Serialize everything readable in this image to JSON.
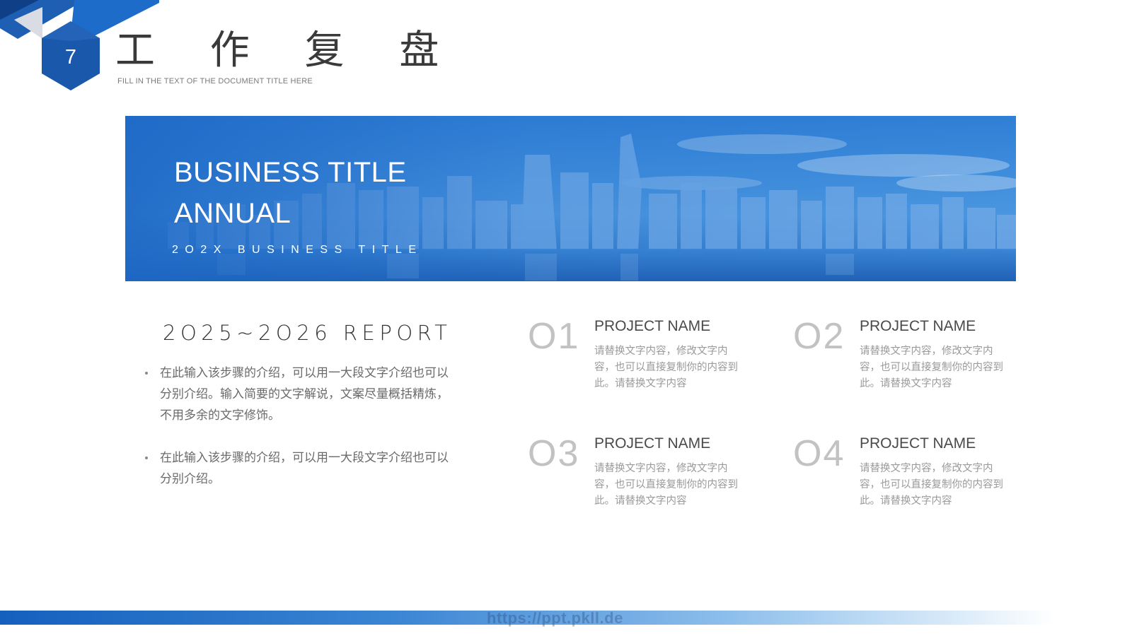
{
  "header": {
    "page_number": "7",
    "title": "工 作 复 盘",
    "subtitle": "FILL IN THE TEXT OF THE DOCUMENT TITLE HERE"
  },
  "banner": {
    "title_line1": "BUSINESS TITLE",
    "title_line2": "ANNUAL",
    "subtitle": "2O2X BUSINESS TITLE"
  },
  "report": {
    "heading": "2O25~2O26 REPORT",
    "bullets": [
      "在此输入该步骤的介绍，可以用一大段文字介绍也可以分别介绍。输入简要的文字解说，文案尽量概括精炼，不用多余的文字修饰。",
      "在此输入该步骤的介绍，可以用一大段文字介绍也可以分别介绍。"
    ]
  },
  "projects": [
    {
      "number": "O1",
      "name": "PROJECT NAME",
      "desc": "请替换文字内容，修改文字内容，也可以直接复制你的内容到此。请替换文字内容"
    },
    {
      "number": "O2",
      "name": "PROJECT NAME",
      "desc": "请替换文字内容，修改文字内容，也可以直接复制你的内容到此。请替换文字内容"
    },
    {
      "number": "O3",
      "name": "PROJECT NAME",
      "desc": "请替换文字内容，修改文字内容，也可以直接复制你的内容到此。请替换文字内容"
    },
    {
      "number": "O4",
      "name": "PROJECT NAME",
      "desc": "请替换文字内容，修改文字内容，也可以直接复制你的内容到此。请替换文字内容"
    }
  ],
  "footer": {
    "watermark": "https://ppt.pkll.de"
  },
  "colors": {
    "primary_blue": "#1560bd",
    "dark_blue": "#134a8e",
    "light_gray_number": "#c2c2c2"
  }
}
